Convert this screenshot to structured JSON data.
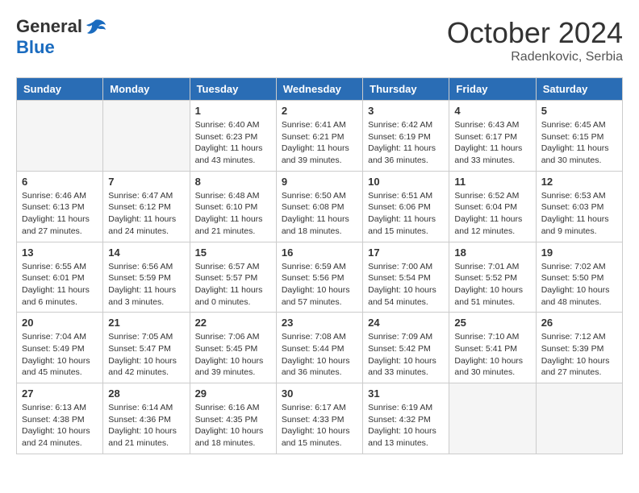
{
  "header": {
    "logo_general": "General",
    "logo_blue": "Blue",
    "month_year": "October 2024",
    "location": "Radenkovic, Serbia"
  },
  "weekdays": [
    "Sunday",
    "Monday",
    "Tuesday",
    "Wednesday",
    "Thursday",
    "Friday",
    "Saturday"
  ],
  "weeks": [
    [
      {
        "day": "",
        "info": ""
      },
      {
        "day": "",
        "info": ""
      },
      {
        "day": "1",
        "info": "Sunrise: 6:40 AM\nSunset: 6:23 PM\nDaylight: 11 hours and 43 minutes."
      },
      {
        "day": "2",
        "info": "Sunrise: 6:41 AM\nSunset: 6:21 PM\nDaylight: 11 hours and 39 minutes."
      },
      {
        "day": "3",
        "info": "Sunrise: 6:42 AM\nSunset: 6:19 PM\nDaylight: 11 hours and 36 minutes."
      },
      {
        "day": "4",
        "info": "Sunrise: 6:43 AM\nSunset: 6:17 PM\nDaylight: 11 hours and 33 minutes."
      },
      {
        "day": "5",
        "info": "Sunrise: 6:45 AM\nSunset: 6:15 PM\nDaylight: 11 hours and 30 minutes."
      }
    ],
    [
      {
        "day": "6",
        "info": "Sunrise: 6:46 AM\nSunset: 6:13 PM\nDaylight: 11 hours and 27 minutes."
      },
      {
        "day": "7",
        "info": "Sunrise: 6:47 AM\nSunset: 6:12 PM\nDaylight: 11 hours and 24 minutes."
      },
      {
        "day": "8",
        "info": "Sunrise: 6:48 AM\nSunset: 6:10 PM\nDaylight: 11 hours and 21 minutes."
      },
      {
        "day": "9",
        "info": "Sunrise: 6:50 AM\nSunset: 6:08 PM\nDaylight: 11 hours and 18 minutes."
      },
      {
        "day": "10",
        "info": "Sunrise: 6:51 AM\nSunset: 6:06 PM\nDaylight: 11 hours and 15 minutes."
      },
      {
        "day": "11",
        "info": "Sunrise: 6:52 AM\nSunset: 6:04 PM\nDaylight: 11 hours and 12 minutes."
      },
      {
        "day": "12",
        "info": "Sunrise: 6:53 AM\nSunset: 6:03 PM\nDaylight: 11 hours and 9 minutes."
      }
    ],
    [
      {
        "day": "13",
        "info": "Sunrise: 6:55 AM\nSunset: 6:01 PM\nDaylight: 11 hours and 6 minutes."
      },
      {
        "day": "14",
        "info": "Sunrise: 6:56 AM\nSunset: 5:59 PM\nDaylight: 11 hours and 3 minutes."
      },
      {
        "day": "15",
        "info": "Sunrise: 6:57 AM\nSunset: 5:57 PM\nDaylight: 11 hours and 0 minutes."
      },
      {
        "day": "16",
        "info": "Sunrise: 6:59 AM\nSunset: 5:56 PM\nDaylight: 10 hours and 57 minutes."
      },
      {
        "day": "17",
        "info": "Sunrise: 7:00 AM\nSunset: 5:54 PM\nDaylight: 10 hours and 54 minutes."
      },
      {
        "day": "18",
        "info": "Sunrise: 7:01 AM\nSunset: 5:52 PM\nDaylight: 10 hours and 51 minutes."
      },
      {
        "day": "19",
        "info": "Sunrise: 7:02 AM\nSunset: 5:50 PM\nDaylight: 10 hours and 48 minutes."
      }
    ],
    [
      {
        "day": "20",
        "info": "Sunrise: 7:04 AM\nSunset: 5:49 PM\nDaylight: 10 hours and 45 minutes."
      },
      {
        "day": "21",
        "info": "Sunrise: 7:05 AM\nSunset: 5:47 PM\nDaylight: 10 hours and 42 minutes."
      },
      {
        "day": "22",
        "info": "Sunrise: 7:06 AM\nSunset: 5:45 PM\nDaylight: 10 hours and 39 minutes."
      },
      {
        "day": "23",
        "info": "Sunrise: 7:08 AM\nSunset: 5:44 PM\nDaylight: 10 hours and 36 minutes."
      },
      {
        "day": "24",
        "info": "Sunrise: 7:09 AM\nSunset: 5:42 PM\nDaylight: 10 hours and 33 minutes."
      },
      {
        "day": "25",
        "info": "Sunrise: 7:10 AM\nSunset: 5:41 PM\nDaylight: 10 hours and 30 minutes."
      },
      {
        "day": "26",
        "info": "Sunrise: 7:12 AM\nSunset: 5:39 PM\nDaylight: 10 hours and 27 minutes."
      }
    ],
    [
      {
        "day": "27",
        "info": "Sunrise: 6:13 AM\nSunset: 4:38 PM\nDaylight: 10 hours and 24 minutes."
      },
      {
        "day": "28",
        "info": "Sunrise: 6:14 AM\nSunset: 4:36 PM\nDaylight: 10 hours and 21 minutes."
      },
      {
        "day": "29",
        "info": "Sunrise: 6:16 AM\nSunset: 4:35 PM\nDaylight: 10 hours and 18 minutes."
      },
      {
        "day": "30",
        "info": "Sunrise: 6:17 AM\nSunset: 4:33 PM\nDaylight: 10 hours and 15 minutes."
      },
      {
        "day": "31",
        "info": "Sunrise: 6:19 AM\nSunset: 4:32 PM\nDaylight: 10 hours and 13 minutes."
      },
      {
        "day": "",
        "info": ""
      },
      {
        "day": "",
        "info": ""
      }
    ]
  ]
}
